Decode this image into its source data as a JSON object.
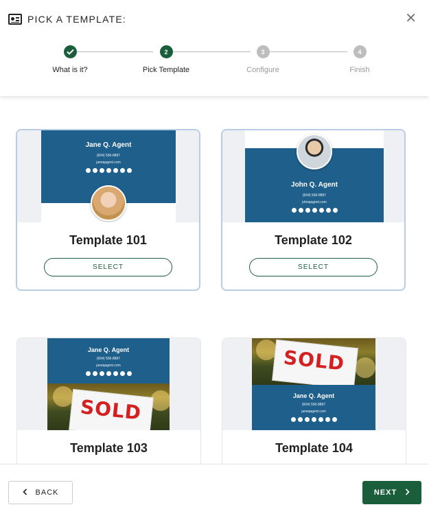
{
  "header": {
    "title": "PICK A TEMPLATE:",
    "close_icon": "close-icon"
  },
  "stepper": [
    {
      "number": "1",
      "label": "What is it?",
      "state": "done"
    },
    {
      "number": "2",
      "label": "Pick Template",
      "state": "active"
    },
    {
      "number": "3",
      "label": "Configure",
      "state": "todo"
    },
    {
      "number": "4",
      "label": "Finish",
      "state": "todo"
    }
  ],
  "templates": [
    {
      "name": "Template 101",
      "select_label": "SELECT",
      "agent": "Jane Q. Agent",
      "phone": "(604) 556-8897",
      "email": "janeqagent.com"
    },
    {
      "name": "Template 102",
      "select_label": "SELECT",
      "agent": "John Q. Agent",
      "phone": "(604) 556-8897",
      "email": "johnqagent.com"
    },
    {
      "name": "Template 103",
      "agent": "Jane Q. Agent",
      "phone": "(604) 556-8897",
      "email": "janeqagent.com",
      "sign_text": "SOLD"
    },
    {
      "name": "Template 104",
      "agent": "Jane Q. Agent",
      "phone": "(604) 556-8897",
      "email": "janeqagent.com",
      "sign_text": "SOLD"
    }
  ],
  "footer": {
    "back_label": "BACK",
    "next_label": "NEXT"
  },
  "colors": {
    "accent": "#1b5e3b",
    "banner": "#1f5f8b",
    "selected_border": "#b8cce6",
    "inactive_step": "#bdbdbd"
  }
}
